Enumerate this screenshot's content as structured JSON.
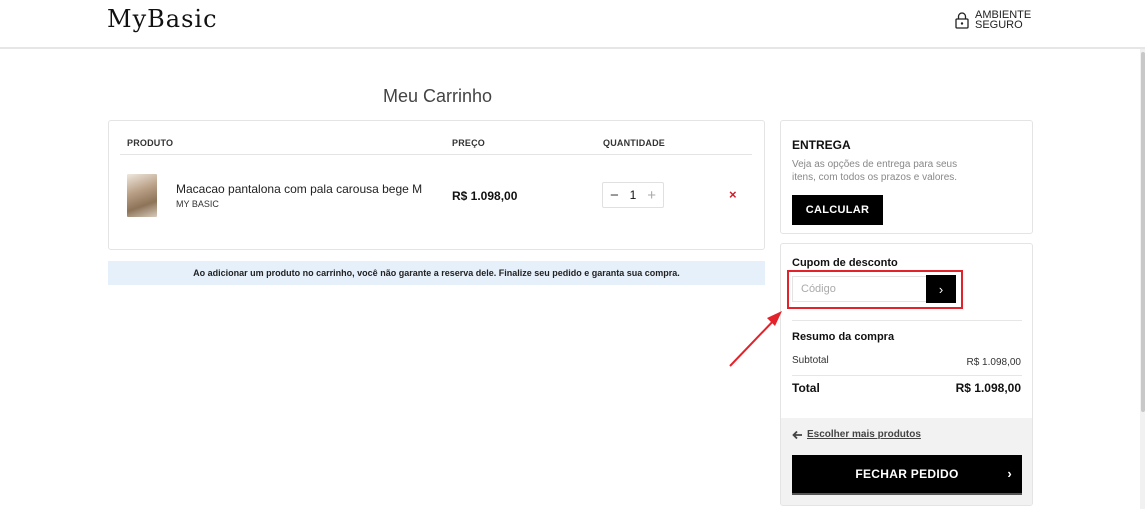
{
  "header": {
    "logo": "MyBasic",
    "secure_line1": "AMBIENTE",
    "secure_line2": "SEGURO"
  },
  "cart": {
    "title": "Meu Carrinho",
    "columns": {
      "product": "PRODUTO",
      "price": "PREÇO",
      "quantity": "QUANTIDADE"
    },
    "items": [
      {
        "name": "Macacao pantalona com pala carousa bege M",
        "brand": "MY BASIC",
        "price": "R$ 1.098,00",
        "quantity": "1",
        "minus": "−",
        "plus": "+",
        "remove_icon": "×"
      }
    ],
    "notice": "Ao adicionar um produto no carrinho, você não garante a reserva dele. Finalize seu pedido e garanta sua compra."
  },
  "shipping": {
    "title": "ENTREGA",
    "description": "Veja as opções de entrega para seus itens, com todos os prazos e valores.",
    "button": "CALCULAR"
  },
  "coupon": {
    "title": "Cupom de desconto",
    "placeholder": "Código",
    "button_icon": "›"
  },
  "summary": {
    "title": "Resumo da compra",
    "subtotal_label": "Subtotal",
    "subtotal_value": "R$ 1.098,00",
    "total_label": "Total",
    "total_value": "R$ 1.098,00",
    "more_products": "Escolher mais produtos",
    "checkout": "FECHAR PEDIDO",
    "checkout_icon": "›"
  },
  "colors": {
    "accent": "#000000",
    "remove": "#d11b2a",
    "annotation": "#e3232b",
    "notice_bg": "#e6f0fb"
  }
}
